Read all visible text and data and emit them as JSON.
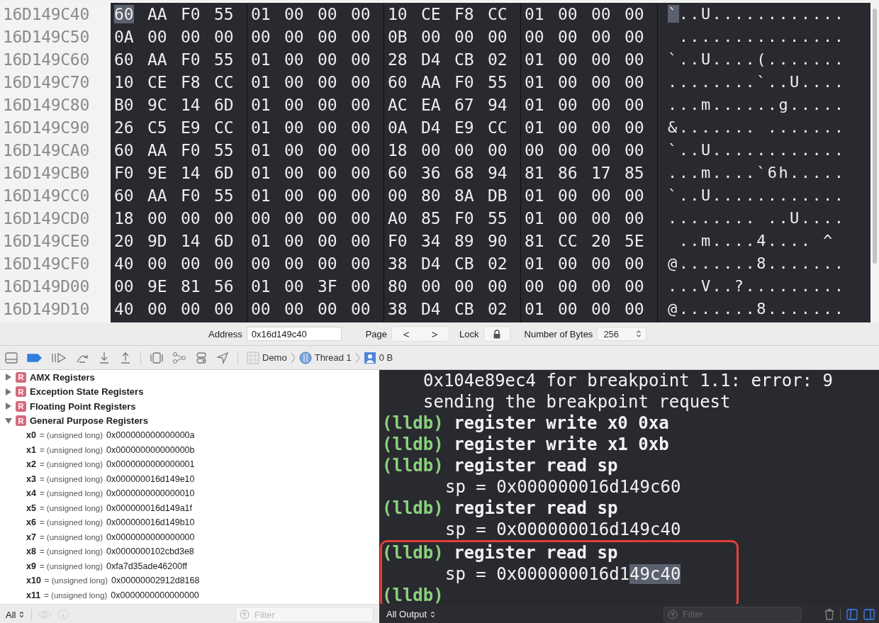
{
  "memory": {
    "rows": [
      {
        "address": "16D149C40",
        "bytes": [
          "60",
          "AA",
          "F0",
          "55",
          "01",
          "00",
          "00",
          "00",
          "10",
          "CE",
          "F8",
          "CC",
          "01",
          "00",
          "00",
          "00"
        ],
        "ascii": "`..U............",
        "selected": true
      },
      {
        "address": "16D149C50",
        "bytes": [
          "0A",
          "00",
          "00",
          "00",
          "00",
          "00",
          "00",
          "00",
          "0B",
          "00",
          "00",
          "00",
          "00",
          "00",
          "00",
          "00"
        ],
        "ascii": " ...............",
        "selected": false
      },
      {
        "address": "16D149C60",
        "bytes": [
          "60",
          "AA",
          "F0",
          "55",
          "01",
          "00",
          "00",
          "00",
          "28",
          "D4",
          "CB",
          "02",
          "01",
          "00",
          "00",
          "00"
        ],
        "ascii": "`..U....(.......",
        "selected": false
      },
      {
        "address": "16D149C70",
        "bytes": [
          "10",
          "CE",
          "F8",
          "CC",
          "01",
          "00",
          "00",
          "00",
          "60",
          "AA",
          "F0",
          "55",
          "01",
          "00",
          "00",
          "00"
        ],
        "ascii": "........`..U....",
        "selected": false
      },
      {
        "address": "16D149C80",
        "bytes": [
          "B0",
          "9C",
          "14",
          "6D",
          "01",
          "00",
          "00",
          "00",
          "AC",
          "EA",
          "67",
          "94",
          "01",
          "00",
          "00",
          "00"
        ],
        "ascii": "...m......g.....",
        "selected": false
      },
      {
        "address": "16D149C90",
        "bytes": [
          "26",
          "C5",
          "E9",
          "CC",
          "01",
          "00",
          "00",
          "00",
          "0A",
          "D4",
          "E9",
          "CC",
          "01",
          "00",
          "00",
          "00"
        ],
        "ascii": "&....... .......",
        "selected": false
      },
      {
        "address": "16D149CA0",
        "bytes": [
          "60",
          "AA",
          "F0",
          "55",
          "01",
          "00",
          "00",
          "00",
          "18",
          "00",
          "00",
          "00",
          "00",
          "00",
          "00",
          "00"
        ],
        "ascii": "`..U............",
        "selected": false
      },
      {
        "address": "16D149CB0",
        "bytes": [
          "F0",
          "9E",
          "14",
          "6D",
          "01",
          "00",
          "00",
          "00",
          "60",
          "36",
          "68",
          "94",
          "81",
          "86",
          "17",
          "85"
        ],
        "ascii": "...m....`6h.....",
        "selected": false
      },
      {
        "address": "16D149CC0",
        "bytes": [
          "60",
          "AA",
          "F0",
          "55",
          "01",
          "00",
          "00",
          "00",
          "00",
          "80",
          "8A",
          "DB",
          "01",
          "00",
          "00",
          "00"
        ],
        "ascii": "`..U............",
        "selected": false
      },
      {
        "address": "16D149CD0",
        "bytes": [
          "18",
          "00",
          "00",
          "00",
          "00",
          "00",
          "00",
          "00",
          "A0",
          "85",
          "F0",
          "55",
          "01",
          "00",
          "00",
          "00"
        ],
        "ascii": "........ ..U....",
        "selected": false
      },
      {
        "address": "16D149CE0",
        "bytes": [
          "20",
          "9D",
          "14",
          "6D",
          "01",
          "00",
          "00",
          "00",
          "F0",
          "34",
          "89",
          "90",
          "81",
          "CC",
          "20",
          "5E"
        ],
        "ascii": " ..m....4.... ^",
        "selected": false
      },
      {
        "address": "16D149CF0",
        "bytes": [
          "40",
          "00",
          "00",
          "00",
          "00",
          "00",
          "00",
          "00",
          "38",
          "D4",
          "CB",
          "02",
          "01",
          "00",
          "00",
          "00"
        ],
        "ascii": "@.......8.......",
        "selected": false
      },
      {
        "address": "16D149D00",
        "bytes": [
          "00",
          "9E",
          "81",
          "56",
          "01",
          "00",
          "3F",
          "00",
          "80",
          "00",
          "00",
          "00",
          "00",
          "00",
          "00",
          "00"
        ],
        "ascii": "...V..?.........",
        "selected": false
      },
      {
        "address": "16D149D10",
        "bytes": [
          "40",
          "00",
          "00",
          "00",
          "00",
          "00",
          "00",
          "00",
          "38",
          "D4",
          "CB",
          "02",
          "01",
          "00",
          "00",
          "00"
        ],
        "ascii": "@.......8.......",
        "selected": false
      }
    ]
  },
  "address_bar": {
    "address_label": "Address",
    "address_value": "0x16d149c40",
    "page_label": "Page",
    "prev": "<",
    "next": ">",
    "lock_label": "Lock",
    "locked": true,
    "bytes_label": "Number of Bytes",
    "bytes_value": "256"
  },
  "debug_bar": {
    "breakpoints_active": true,
    "breadcrumb": [
      "Demo",
      "Thread 1",
      "0 B"
    ]
  },
  "variables": {
    "groups": [
      {
        "name": "AMX Registers",
        "badge": "R",
        "expanded": false
      },
      {
        "name": "Exception State Registers",
        "badge": "R",
        "expanded": false
      },
      {
        "name": "Floating Point Registers",
        "badge": "R",
        "expanded": false
      },
      {
        "name": "General Purpose Registers",
        "badge": "R",
        "expanded": true,
        "children": [
          {
            "name": "x0",
            "type": "= (unsigned long)",
            "value": "0x000000000000000a"
          },
          {
            "name": "x1",
            "type": "= (unsigned long)",
            "value": "0x000000000000000b"
          },
          {
            "name": "x2",
            "type": "= (unsigned long)",
            "value": "0x0000000000000001"
          },
          {
            "name": "x3",
            "type": "= (unsigned long)",
            "value": "0x000000016d149e10"
          },
          {
            "name": "x4",
            "type": "= (unsigned long)",
            "value": "0x0000000000000010"
          },
          {
            "name": "x5",
            "type": "= (unsigned long)",
            "value": "0x000000016d149a1f"
          },
          {
            "name": "x6",
            "type": "= (unsigned long)",
            "value": "0x000000016d149b10"
          },
          {
            "name": "x7",
            "type": "= (unsigned long)",
            "value": "0x0000000000000000"
          },
          {
            "name": "x8",
            "type": "= (unsigned long)",
            "value": "0x0000000102cbd3e8"
          },
          {
            "name": "x9",
            "type": "= (unsigned long)",
            "value": "0xfa7d35ade46200ff"
          },
          {
            "name": "x10",
            "type": "= (unsigned long)",
            "value": "0x00000002912d8168"
          },
          {
            "name": "x11",
            "type": "= (unsigned long)",
            "value": "0x0000000000000000"
          }
        ]
      }
    ],
    "scope": "All",
    "filter_placeholder": "Filter"
  },
  "console": {
    "lines": [
      {
        "kind": "wrapped",
        "text": "0x104e89ec4 for breakpoint 1.1: error: 9",
        "boxed": false
      },
      {
        "kind": "wrapped",
        "text": "sending the breakpoint request",
        "boxed": false
      },
      {
        "kind": "prompt",
        "prompt": "(lldb)",
        "text": "register write x0 0xa",
        "boxed": false
      },
      {
        "kind": "prompt",
        "prompt": "(lldb)",
        "text": "register write x1 0xb",
        "boxed": false
      },
      {
        "kind": "prompt",
        "prompt": "(lldb)",
        "text": "register read sp",
        "boxed": false
      },
      {
        "kind": "output",
        "text": "sp = 0x000000016d149c60",
        "boxed": false
      },
      {
        "kind": "prompt",
        "prompt": "(lldb)",
        "text": "register read sp",
        "boxed": false
      },
      {
        "kind": "output",
        "text": "sp = 0x000000016d149c40",
        "boxed": false
      },
      {
        "kind": "prompt",
        "prompt": "(lldb)",
        "text": "register read sp",
        "boxed": true
      },
      {
        "kind": "output",
        "text": "sp = 0x000000016d1",
        "highlight": "49c40",
        "boxed": true
      },
      {
        "kind": "prompt",
        "prompt": "(lldb)",
        "boxed": true
      }
    ],
    "output_scope": "All Output",
    "filter_placeholder": "Filter",
    "left_panel_visible": true,
    "right_panel_visible": true
  }
}
